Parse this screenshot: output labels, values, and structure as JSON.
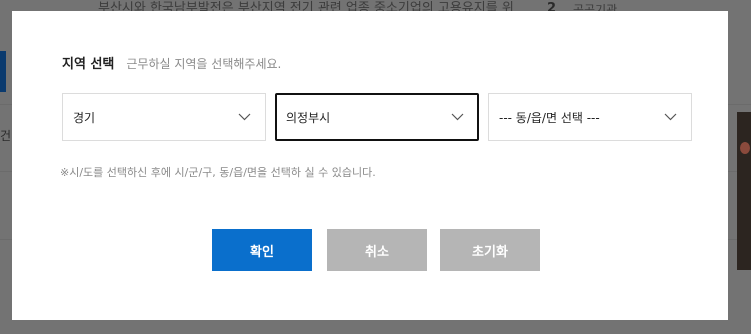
{
  "background": {
    "text": "부산시와 한국남부발전은 부산지역 전기 관련 업종 중소기업의 고용유지를 위",
    "number": "2",
    "label": "공공기관",
    "side_text": "건"
  },
  "modal": {
    "title": "지역 선택",
    "subtitle": "근무하실 지역을 선택해주세요.",
    "selects": [
      {
        "value": "경기"
      },
      {
        "value": "의정부시"
      },
      {
        "value": "--- 동/읍/면 선택 ---"
      }
    ],
    "help": "※시/도를 선택하신 후에 시/군/구, 동/읍/면을 선택하 실 수 있습니다.",
    "buttons": {
      "confirm": "확인",
      "cancel": "취소",
      "reset": "초기화"
    },
    "colors": {
      "primary": "#0a6fcc",
      "disabled": "#b5b5b5"
    }
  }
}
